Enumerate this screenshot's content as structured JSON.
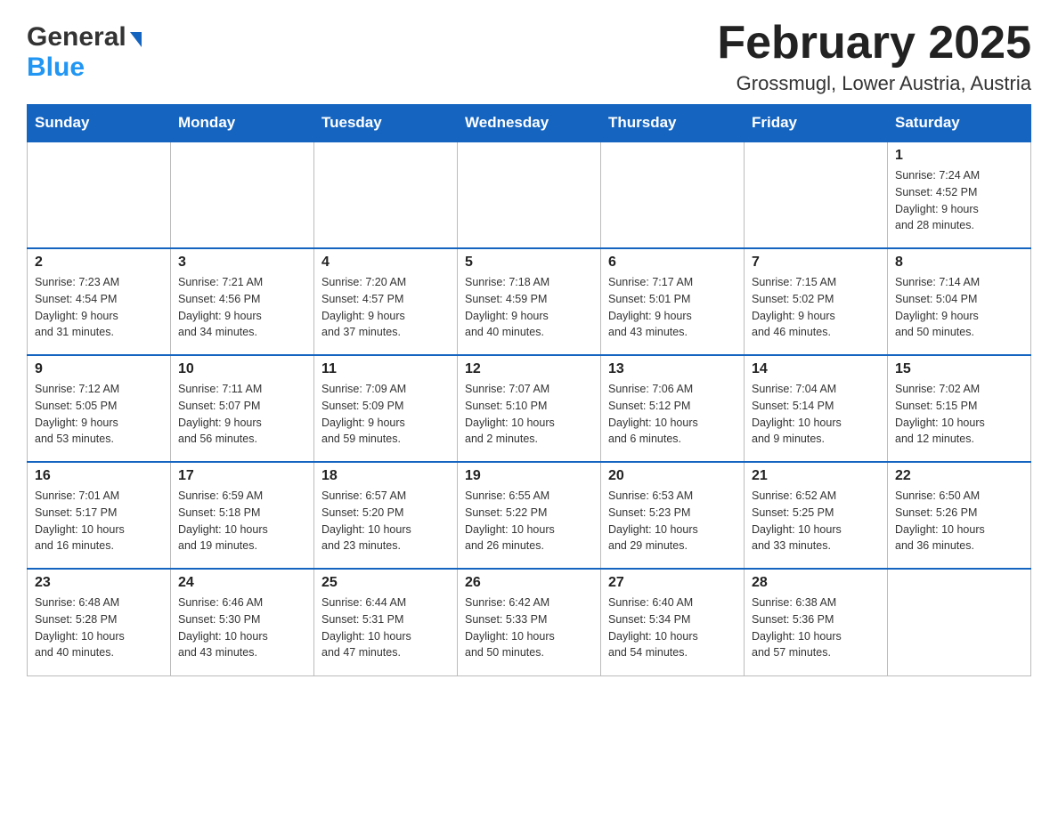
{
  "header": {
    "logo_general": "General",
    "logo_blue": "Blue",
    "title": "February 2025",
    "subtitle": "Grossmugl, Lower Austria, Austria"
  },
  "weekdays": [
    "Sunday",
    "Monday",
    "Tuesday",
    "Wednesday",
    "Thursday",
    "Friday",
    "Saturday"
  ],
  "weeks": [
    [
      {
        "day": "",
        "info": ""
      },
      {
        "day": "",
        "info": ""
      },
      {
        "day": "",
        "info": ""
      },
      {
        "day": "",
        "info": ""
      },
      {
        "day": "",
        "info": ""
      },
      {
        "day": "",
        "info": ""
      },
      {
        "day": "1",
        "info": "Sunrise: 7:24 AM\nSunset: 4:52 PM\nDaylight: 9 hours\nand 28 minutes."
      }
    ],
    [
      {
        "day": "2",
        "info": "Sunrise: 7:23 AM\nSunset: 4:54 PM\nDaylight: 9 hours\nand 31 minutes."
      },
      {
        "day": "3",
        "info": "Sunrise: 7:21 AM\nSunset: 4:56 PM\nDaylight: 9 hours\nand 34 minutes."
      },
      {
        "day": "4",
        "info": "Sunrise: 7:20 AM\nSunset: 4:57 PM\nDaylight: 9 hours\nand 37 minutes."
      },
      {
        "day": "5",
        "info": "Sunrise: 7:18 AM\nSunset: 4:59 PM\nDaylight: 9 hours\nand 40 minutes."
      },
      {
        "day": "6",
        "info": "Sunrise: 7:17 AM\nSunset: 5:01 PM\nDaylight: 9 hours\nand 43 minutes."
      },
      {
        "day": "7",
        "info": "Sunrise: 7:15 AM\nSunset: 5:02 PM\nDaylight: 9 hours\nand 46 minutes."
      },
      {
        "day": "8",
        "info": "Sunrise: 7:14 AM\nSunset: 5:04 PM\nDaylight: 9 hours\nand 50 minutes."
      }
    ],
    [
      {
        "day": "9",
        "info": "Sunrise: 7:12 AM\nSunset: 5:05 PM\nDaylight: 9 hours\nand 53 minutes."
      },
      {
        "day": "10",
        "info": "Sunrise: 7:11 AM\nSunset: 5:07 PM\nDaylight: 9 hours\nand 56 minutes."
      },
      {
        "day": "11",
        "info": "Sunrise: 7:09 AM\nSunset: 5:09 PM\nDaylight: 9 hours\nand 59 minutes."
      },
      {
        "day": "12",
        "info": "Sunrise: 7:07 AM\nSunset: 5:10 PM\nDaylight: 10 hours\nand 2 minutes."
      },
      {
        "day": "13",
        "info": "Sunrise: 7:06 AM\nSunset: 5:12 PM\nDaylight: 10 hours\nand 6 minutes."
      },
      {
        "day": "14",
        "info": "Sunrise: 7:04 AM\nSunset: 5:14 PM\nDaylight: 10 hours\nand 9 minutes."
      },
      {
        "day": "15",
        "info": "Sunrise: 7:02 AM\nSunset: 5:15 PM\nDaylight: 10 hours\nand 12 minutes."
      }
    ],
    [
      {
        "day": "16",
        "info": "Sunrise: 7:01 AM\nSunset: 5:17 PM\nDaylight: 10 hours\nand 16 minutes."
      },
      {
        "day": "17",
        "info": "Sunrise: 6:59 AM\nSunset: 5:18 PM\nDaylight: 10 hours\nand 19 minutes."
      },
      {
        "day": "18",
        "info": "Sunrise: 6:57 AM\nSunset: 5:20 PM\nDaylight: 10 hours\nand 23 minutes."
      },
      {
        "day": "19",
        "info": "Sunrise: 6:55 AM\nSunset: 5:22 PM\nDaylight: 10 hours\nand 26 minutes."
      },
      {
        "day": "20",
        "info": "Sunrise: 6:53 AM\nSunset: 5:23 PM\nDaylight: 10 hours\nand 29 minutes."
      },
      {
        "day": "21",
        "info": "Sunrise: 6:52 AM\nSunset: 5:25 PM\nDaylight: 10 hours\nand 33 minutes."
      },
      {
        "day": "22",
        "info": "Sunrise: 6:50 AM\nSunset: 5:26 PM\nDaylight: 10 hours\nand 36 minutes."
      }
    ],
    [
      {
        "day": "23",
        "info": "Sunrise: 6:48 AM\nSunset: 5:28 PM\nDaylight: 10 hours\nand 40 minutes."
      },
      {
        "day": "24",
        "info": "Sunrise: 6:46 AM\nSunset: 5:30 PM\nDaylight: 10 hours\nand 43 minutes."
      },
      {
        "day": "25",
        "info": "Sunrise: 6:44 AM\nSunset: 5:31 PM\nDaylight: 10 hours\nand 47 minutes."
      },
      {
        "day": "26",
        "info": "Sunrise: 6:42 AM\nSunset: 5:33 PM\nDaylight: 10 hours\nand 50 minutes."
      },
      {
        "day": "27",
        "info": "Sunrise: 6:40 AM\nSunset: 5:34 PM\nDaylight: 10 hours\nand 54 minutes."
      },
      {
        "day": "28",
        "info": "Sunrise: 6:38 AM\nSunset: 5:36 PM\nDaylight: 10 hours\nand 57 minutes."
      },
      {
        "day": "",
        "info": ""
      }
    ]
  ]
}
